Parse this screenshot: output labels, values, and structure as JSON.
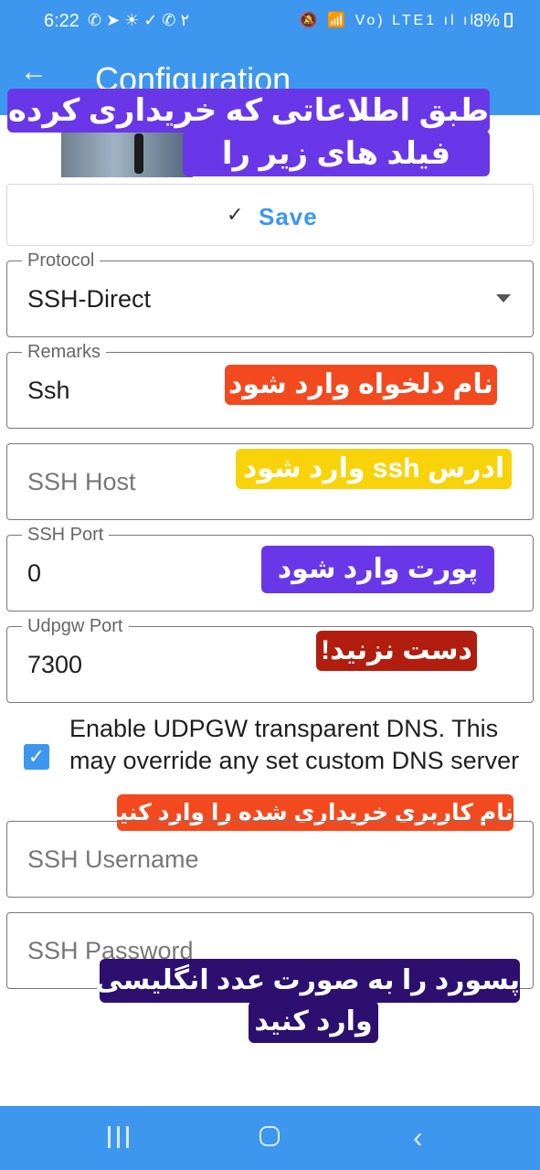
{
  "status_bar": {
    "time": "6:22",
    "left_icons": "✆ ➤ ☀ ✓ ✆ ٢",
    "right_icons": "🔕 📶 Vo) LTE1 ıl ıl",
    "battery": "8%"
  },
  "app_bar": {
    "back_icon": "←",
    "title": "Configuration"
  },
  "banner": {
    "line1": "طبق اطلاعاتی که خریداری کرده اید",
    "line2": "فیلد های زیر را پرکنید."
  },
  "save_button": {
    "icon": "✓",
    "label": "Save"
  },
  "fields": {
    "protocol": {
      "label": "Protocol",
      "value": "SSH-Direct"
    },
    "remarks": {
      "label": "Remarks",
      "value": "Ssh"
    },
    "ssh_host": {
      "placeholder": "SSH Host"
    },
    "ssh_port": {
      "label": "SSH Port",
      "value": "0"
    },
    "udpgw_port": {
      "label": "Udpgw Port",
      "value": "7300"
    },
    "ssh_username": {
      "placeholder": "SSH Username"
    },
    "ssh_password": {
      "placeholder": "SSH Password"
    }
  },
  "udpgw_checkbox": {
    "checked": true,
    "text": "Enable UDPGW transparent DNS. This may override any set custom DNS server"
  },
  "notes": {
    "remarks": "نام دلخواه وارد شود",
    "host": "ادرس ssh وارد شود",
    "port": "پورت وارد شود",
    "udpgw": "دست نزنید!",
    "username": "نام کاربری خریداری شده را وارد کنید",
    "password_line1": "پسورد را به صورت عدد انگلیسی",
    "password_line2": "وارد کنید"
  },
  "colors": {
    "accent": "#3d97ee",
    "note_purple": "#6a37e8",
    "note_orange": "#f24a1e",
    "note_yellow": "#f8d30a",
    "note_red": "#b11d0e",
    "note_indigo": "#2c0f6e"
  }
}
